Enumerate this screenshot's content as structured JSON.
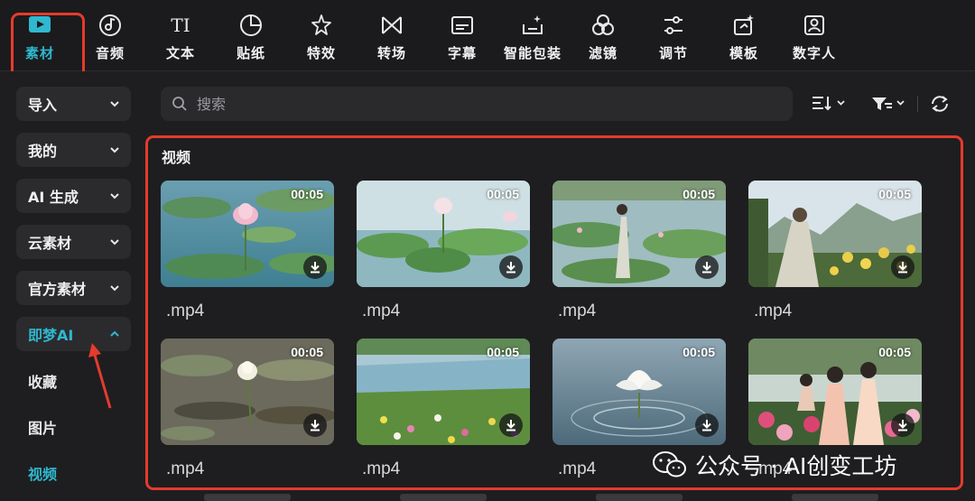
{
  "toolbar": {
    "items": [
      {
        "label": "素材",
        "icon": "play-box-icon",
        "active": true
      },
      {
        "label": "音频",
        "icon": "music-disc-icon"
      },
      {
        "label": "文本",
        "icon": "text-ti-icon",
        "glyph": "TI"
      },
      {
        "label": "贴纸",
        "icon": "sticker-icon"
      },
      {
        "label": "特效",
        "icon": "sparkle-star-icon"
      },
      {
        "label": "转场",
        "icon": "transition-bowtie-icon"
      },
      {
        "label": "字幕",
        "icon": "subtitle-icon"
      },
      {
        "label": "智能包装",
        "icon": "smart-package-icon"
      },
      {
        "label": "滤镜",
        "icon": "filter-circles-icon"
      },
      {
        "label": "调节",
        "icon": "adjust-sliders-icon"
      },
      {
        "label": "模板",
        "icon": "template-icon"
      },
      {
        "label": "数字人",
        "icon": "digital-human-icon"
      }
    ]
  },
  "sidebar": {
    "groups": [
      {
        "label": "导入",
        "expanded": false
      },
      {
        "label": "我的",
        "expanded": false
      },
      {
        "label": "AI 生成",
        "expanded": false
      },
      {
        "label": "云素材",
        "expanded": false
      },
      {
        "label": "官方素材",
        "expanded": false
      },
      {
        "label": "即梦AI",
        "expanded": true
      }
    ],
    "subitems": [
      {
        "label": "收藏"
      },
      {
        "label": "图片"
      },
      {
        "label": "视频",
        "active": true
      }
    ]
  },
  "search": {
    "placeholder": "搜索"
  },
  "section": {
    "title": "视频"
  },
  "videos": [
    {
      "duration": "00:05",
      "filename": ".mp4",
      "scene": "pink lotus on lily pads"
    },
    {
      "duration": "00:05",
      "filename": ".mp4",
      "scene": "lotus pond with leaves"
    },
    {
      "duration": "00:05",
      "filename": ".mp4",
      "scene": "man in robe by lotus lake"
    },
    {
      "duration": "00:05",
      "filename": ".mp4",
      "scene": "old man in chrysanthemum garden"
    },
    {
      "duration": "00:05",
      "filename": ".mp4",
      "scene": "white lotus on muddy pond"
    },
    {
      "duration": "00:05",
      "filename": ".mp4",
      "scene": "flower meadow by river"
    },
    {
      "duration": "00:05",
      "filename": ".mp4",
      "scene": "white lotus on water ripples"
    },
    {
      "duration": "00:05",
      "filename": ".mp4",
      "scene": "women among peonies"
    }
  ],
  "watermark": {
    "text": "公众号 · AI创变工坊"
  },
  "colors": {
    "accent": "#2fb8cf",
    "highlight": "#e53b2c",
    "background": "#1e1e20"
  }
}
